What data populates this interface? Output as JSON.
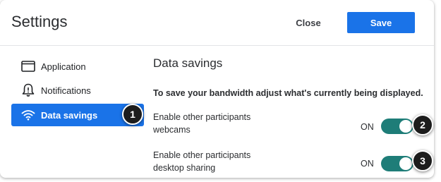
{
  "header": {
    "title": "Settings",
    "close_label": "Close",
    "save_label": "Save"
  },
  "sidebar": {
    "items": [
      {
        "label": "Application",
        "icon": "window-icon",
        "active": false
      },
      {
        "label": "Notifications",
        "icon": "bell-alert-icon",
        "active": false
      },
      {
        "label": "Data savings",
        "icon": "wifi-icon",
        "active": true
      }
    ]
  },
  "main": {
    "section_title": "Data savings",
    "description": "To save your bandwidth adjust what's currently being displayed.",
    "settings": [
      {
        "label": "Enable other participants webcams",
        "state_label": "ON",
        "enabled": true
      },
      {
        "label": "Enable other participants desktop sharing",
        "state_label": "ON",
        "enabled": true
      }
    ]
  },
  "callouts": [
    "1",
    "2",
    "3"
  ],
  "colors": {
    "accent": "#1a73e8",
    "toggle_on": "#1e7d78",
    "callout": "#1c1c1c"
  }
}
